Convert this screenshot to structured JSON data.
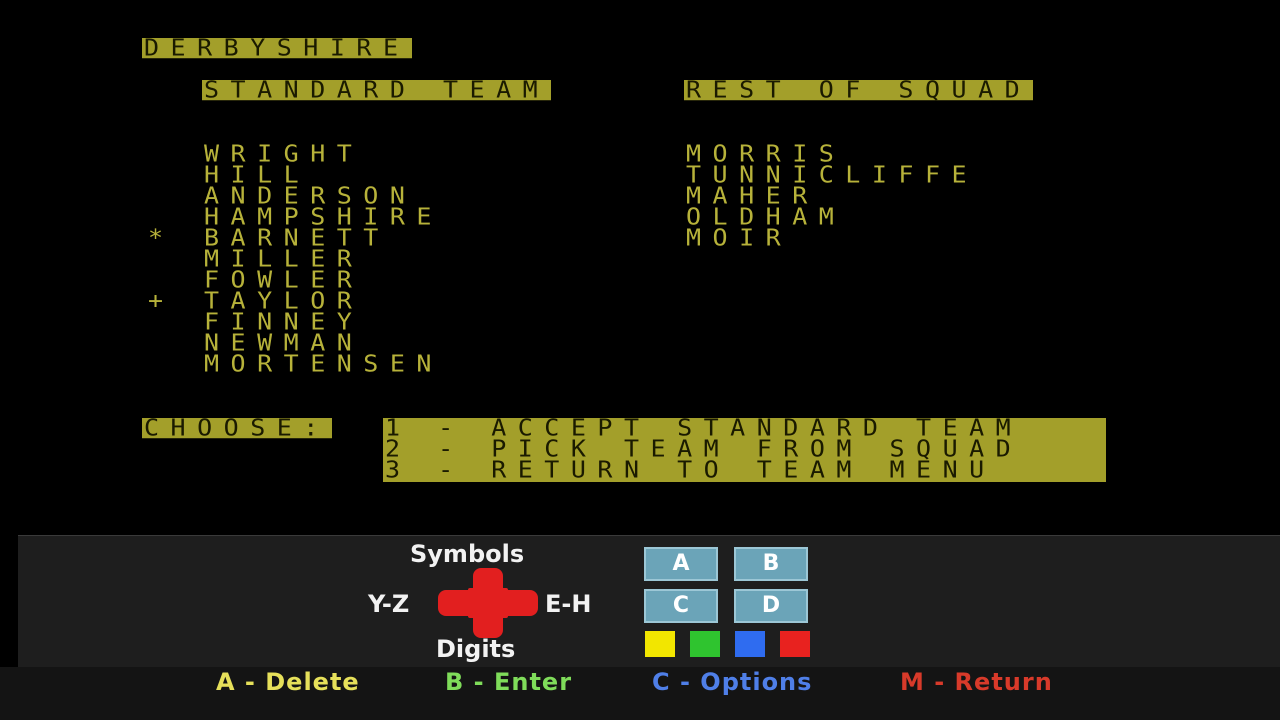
{
  "screen": {
    "team_name": "DERBYSHIRE",
    "standard_header": "STANDARD TEAM",
    "squad_header": "REST OF SQUAD",
    "standard_team": [
      "WRIGHT",
      "HILL",
      "ANDERSON",
      "HAMPSHIRE",
      "BARNETT",
      "MILLER",
      "FOWLER",
      "TAYLOR",
      "FINNEY",
      "NEWMAN",
      "MORTENSEN"
    ],
    "markers": {
      "captain_row": 4,
      "captain_symbol": "*",
      "keeper_row": 7,
      "keeper_symbol": "+"
    },
    "rest_of_squad": [
      "MORRIS",
      "TUNNICLIFFE",
      "MAHER",
      "OLDHAM",
      "MOIR"
    ],
    "choose_label": "CHOOSE:",
    "options": [
      "1 - ACCEPT STANDARD TEAM",
      "2 - PICK TEAM FROM SQUAD",
      "3 - RETURN TO TEAM MENU"
    ]
  },
  "overlay": {
    "dpad_up": "Symbols",
    "dpad_left": "Y-Z",
    "dpad_right": "E-H",
    "dpad_down": "Digits",
    "keys": [
      "A",
      "B",
      "C",
      "D"
    ],
    "color_buttons": [
      "#f2e600",
      "#2fc42f",
      "#2f6cf0",
      "#e8221f"
    ],
    "legend": [
      {
        "text": "A - Delete",
        "color": "#e6e05a"
      },
      {
        "text": "B - Enter",
        "color": "#7fdc5a"
      },
      {
        "text": "C - Options",
        "color": "#4f7fe8"
      },
      {
        "text": "M - Return",
        "color": "#d83a2a"
      }
    ]
  }
}
